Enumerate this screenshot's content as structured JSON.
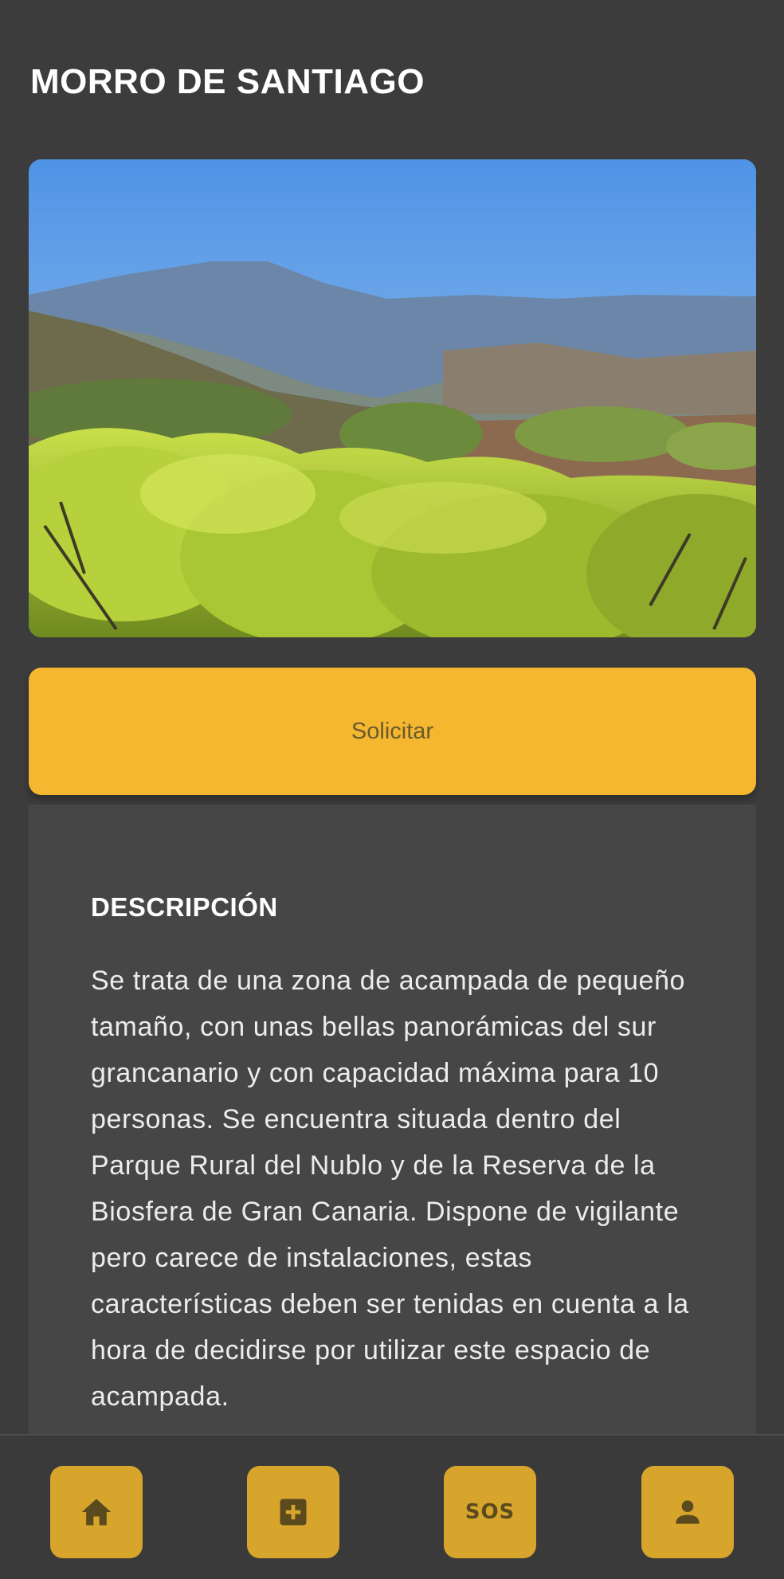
{
  "header": {
    "title": "MORRO DE SANTIAGO"
  },
  "hero": {
    "alt": "Paisaje de Morro de Santiago"
  },
  "actions": {
    "request_label": "Solicitar"
  },
  "description": {
    "heading": "DESCRIPCIÓN",
    "text": "Se trata de una zona de acampada de pequeño tamaño, con unas bellas panorámicas del sur grancanario y con capacidad máxima para 10 personas. Se encuentra situada dentro del Parque Rural del Nublo y de la Reserva de la Biosfera de Gran Canaria. Dispone de vigilante pero carece de instalaciones, estas características deben ser tenidas en cuenta a la hora de decidirse por utilizar este espacio de acampada."
  },
  "bottom_nav": {
    "items": [
      {
        "icon": "home-icon"
      },
      {
        "icon": "add-box-icon"
      },
      {
        "icon": "sos-icon",
        "label": "SOS"
      },
      {
        "icon": "person-icon"
      }
    ]
  },
  "colors": {
    "background": "#3c3c3c",
    "card": "#464646",
    "accent": "#f5b730",
    "nav_button": "#d8a52c"
  }
}
